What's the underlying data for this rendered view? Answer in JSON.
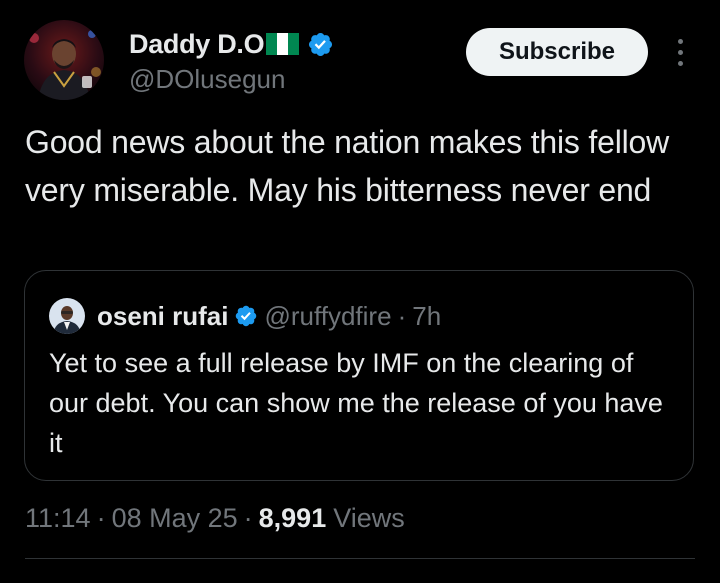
{
  "author": {
    "name": "Daddy D.O",
    "handle": "@DOlusegun",
    "flag": "nigeria-flag-icon",
    "verified": true
  },
  "subscribe_label": "Subscribe",
  "tweet_text": "Good news about the nation makes this fellow very miserable. May his bitterness never end",
  "quote": {
    "name": "oseni rufai",
    "handle": "@ruffydfire",
    "separator": "·",
    "time": "7h",
    "text": "Yet to see a full release by IMF on the clearing of our debt. You can show me the release of you have it"
  },
  "meta": {
    "time": "11:14",
    "separator": "·",
    "date": "08 May 25",
    "views_count": "8,991",
    "views_label": "Views"
  },
  "colors": {
    "background": "#000000",
    "text": "#e7e9ea",
    "secondary": "#71767b",
    "verified_blue": "#1d9bf0",
    "border": "#2f3336",
    "flag_green": "#008751"
  }
}
